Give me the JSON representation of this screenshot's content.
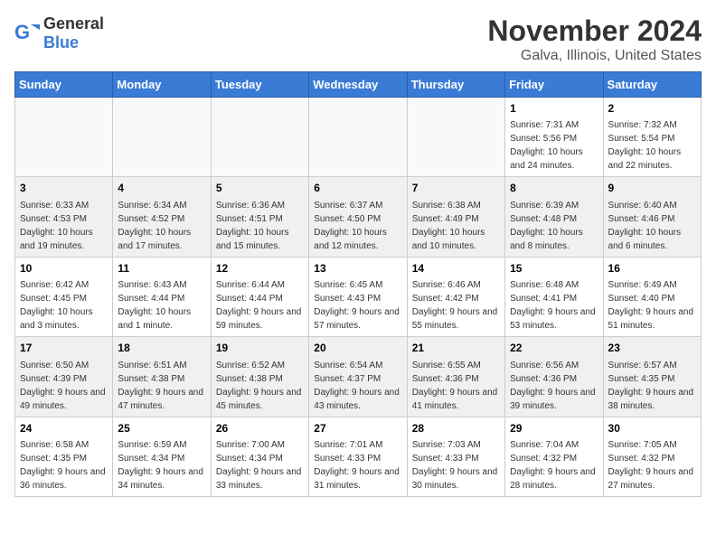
{
  "header": {
    "logo_general": "General",
    "logo_blue": "Blue",
    "month_year": "November 2024",
    "location": "Galva, Illinois, United States"
  },
  "days_of_week": [
    "Sunday",
    "Monday",
    "Tuesday",
    "Wednesday",
    "Thursday",
    "Friday",
    "Saturday"
  ],
  "weeks": [
    [
      {
        "day": "",
        "info": ""
      },
      {
        "day": "",
        "info": ""
      },
      {
        "day": "",
        "info": ""
      },
      {
        "day": "",
        "info": ""
      },
      {
        "day": "",
        "info": ""
      },
      {
        "day": "1",
        "info": "Sunrise: 7:31 AM\nSunset: 5:56 PM\nDaylight: 10 hours and 24 minutes."
      },
      {
        "day": "2",
        "info": "Sunrise: 7:32 AM\nSunset: 5:54 PM\nDaylight: 10 hours and 22 minutes."
      }
    ],
    [
      {
        "day": "3",
        "info": "Sunrise: 6:33 AM\nSunset: 4:53 PM\nDaylight: 10 hours and 19 minutes."
      },
      {
        "day": "4",
        "info": "Sunrise: 6:34 AM\nSunset: 4:52 PM\nDaylight: 10 hours and 17 minutes."
      },
      {
        "day": "5",
        "info": "Sunrise: 6:36 AM\nSunset: 4:51 PM\nDaylight: 10 hours and 15 minutes."
      },
      {
        "day": "6",
        "info": "Sunrise: 6:37 AM\nSunset: 4:50 PM\nDaylight: 10 hours and 12 minutes."
      },
      {
        "day": "7",
        "info": "Sunrise: 6:38 AM\nSunset: 4:49 PM\nDaylight: 10 hours and 10 minutes."
      },
      {
        "day": "8",
        "info": "Sunrise: 6:39 AM\nSunset: 4:48 PM\nDaylight: 10 hours and 8 minutes."
      },
      {
        "day": "9",
        "info": "Sunrise: 6:40 AM\nSunset: 4:46 PM\nDaylight: 10 hours and 6 minutes."
      }
    ],
    [
      {
        "day": "10",
        "info": "Sunrise: 6:42 AM\nSunset: 4:45 PM\nDaylight: 10 hours and 3 minutes."
      },
      {
        "day": "11",
        "info": "Sunrise: 6:43 AM\nSunset: 4:44 PM\nDaylight: 10 hours and 1 minute."
      },
      {
        "day": "12",
        "info": "Sunrise: 6:44 AM\nSunset: 4:44 PM\nDaylight: 9 hours and 59 minutes."
      },
      {
        "day": "13",
        "info": "Sunrise: 6:45 AM\nSunset: 4:43 PM\nDaylight: 9 hours and 57 minutes."
      },
      {
        "day": "14",
        "info": "Sunrise: 6:46 AM\nSunset: 4:42 PM\nDaylight: 9 hours and 55 minutes."
      },
      {
        "day": "15",
        "info": "Sunrise: 6:48 AM\nSunset: 4:41 PM\nDaylight: 9 hours and 53 minutes."
      },
      {
        "day": "16",
        "info": "Sunrise: 6:49 AM\nSunset: 4:40 PM\nDaylight: 9 hours and 51 minutes."
      }
    ],
    [
      {
        "day": "17",
        "info": "Sunrise: 6:50 AM\nSunset: 4:39 PM\nDaylight: 9 hours and 49 minutes."
      },
      {
        "day": "18",
        "info": "Sunrise: 6:51 AM\nSunset: 4:38 PM\nDaylight: 9 hours and 47 minutes."
      },
      {
        "day": "19",
        "info": "Sunrise: 6:52 AM\nSunset: 4:38 PM\nDaylight: 9 hours and 45 minutes."
      },
      {
        "day": "20",
        "info": "Sunrise: 6:54 AM\nSunset: 4:37 PM\nDaylight: 9 hours and 43 minutes."
      },
      {
        "day": "21",
        "info": "Sunrise: 6:55 AM\nSunset: 4:36 PM\nDaylight: 9 hours and 41 minutes."
      },
      {
        "day": "22",
        "info": "Sunrise: 6:56 AM\nSunset: 4:36 PM\nDaylight: 9 hours and 39 minutes."
      },
      {
        "day": "23",
        "info": "Sunrise: 6:57 AM\nSunset: 4:35 PM\nDaylight: 9 hours and 38 minutes."
      }
    ],
    [
      {
        "day": "24",
        "info": "Sunrise: 6:58 AM\nSunset: 4:35 PM\nDaylight: 9 hours and 36 minutes."
      },
      {
        "day": "25",
        "info": "Sunrise: 6:59 AM\nSunset: 4:34 PM\nDaylight: 9 hours and 34 minutes."
      },
      {
        "day": "26",
        "info": "Sunrise: 7:00 AM\nSunset: 4:34 PM\nDaylight: 9 hours and 33 minutes."
      },
      {
        "day": "27",
        "info": "Sunrise: 7:01 AM\nSunset: 4:33 PM\nDaylight: 9 hours and 31 minutes."
      },
      {
        "day": "28",
        "info": "Sunrise: 7:03 AM\nSunset: 4:33 PM\nDaylight: 9 hours and 30 minutes."
      },
      {
        "day": "29",
        "info": "Sunrise: 7:04 AM\nSunset: 4:32 PM\nDaylight: 9 hours and 28 minutes."
      },
      {
        "day": "30",
        "info": "Sunrise: 7:05 AM\nSunset: 4:32 PM\nDaylight: 9 hours and 27 minutes."
      }
    ]
  ]
}
